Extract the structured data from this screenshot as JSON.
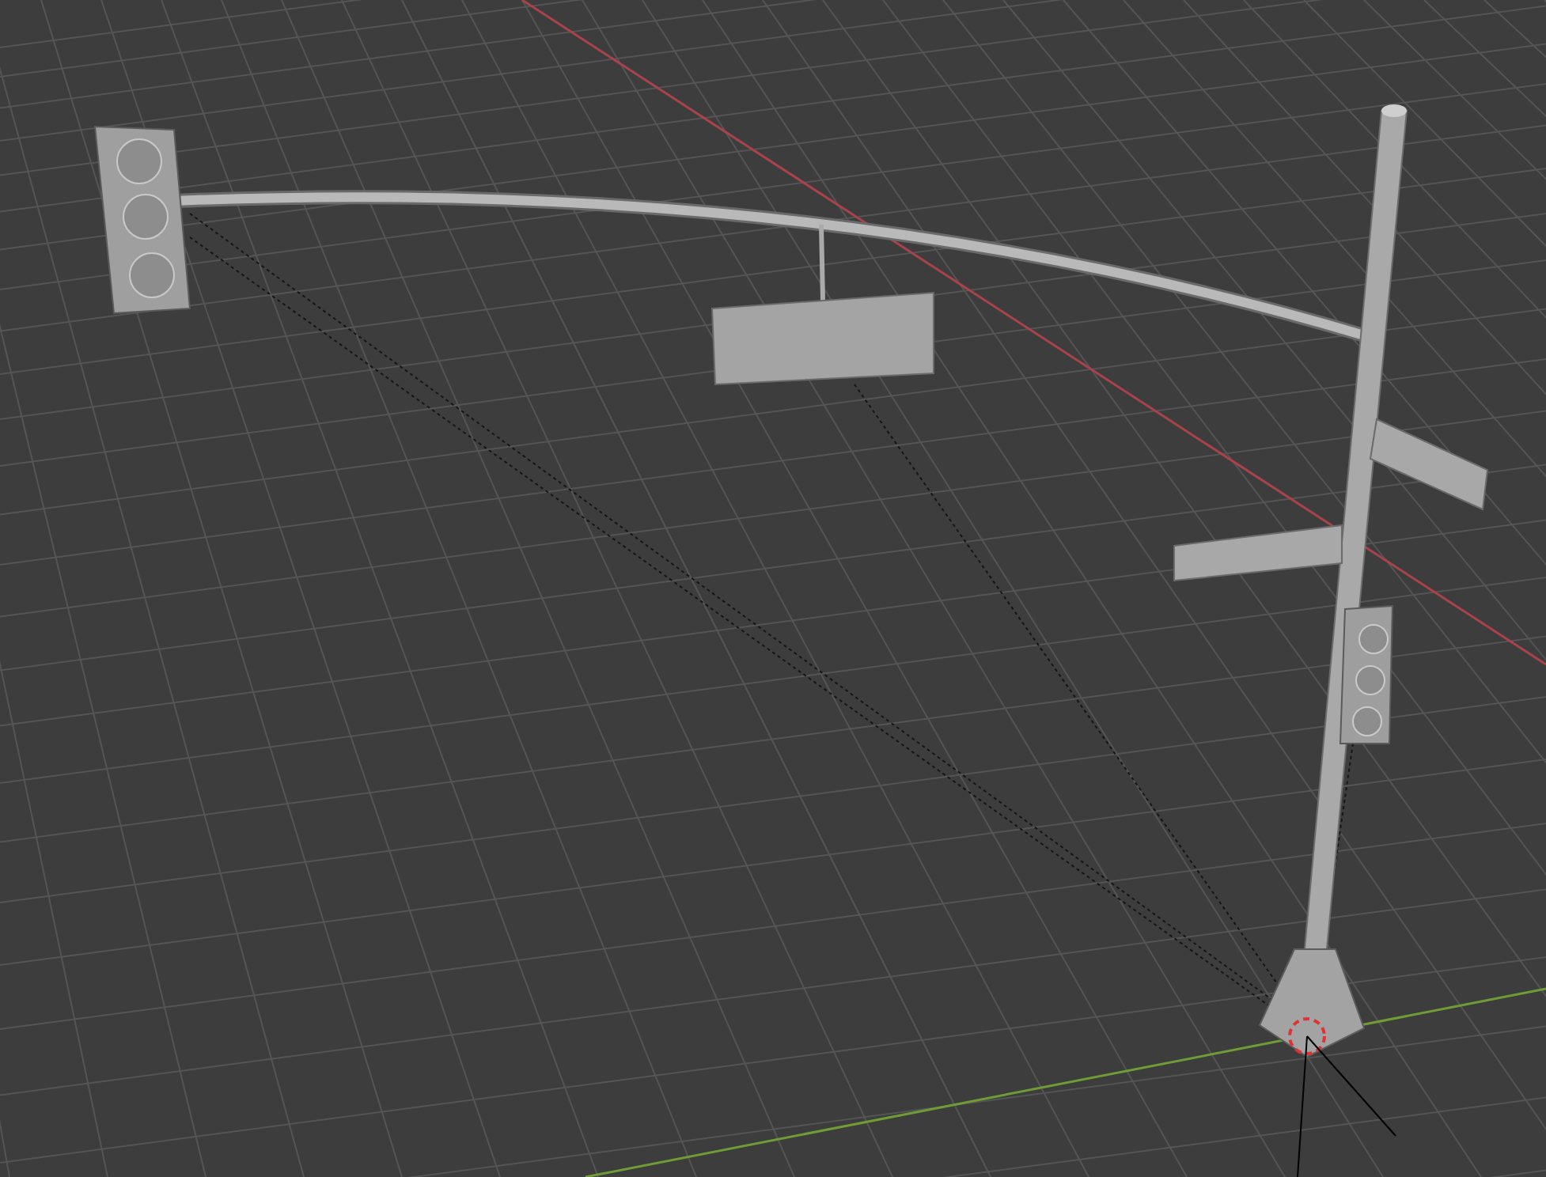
{
  "viewport": {
    "axis_lines": [
      {
        "color": "#a8434a"
      },
      {
        "color": "#6f9c34"
      }
    ]
  }
}
